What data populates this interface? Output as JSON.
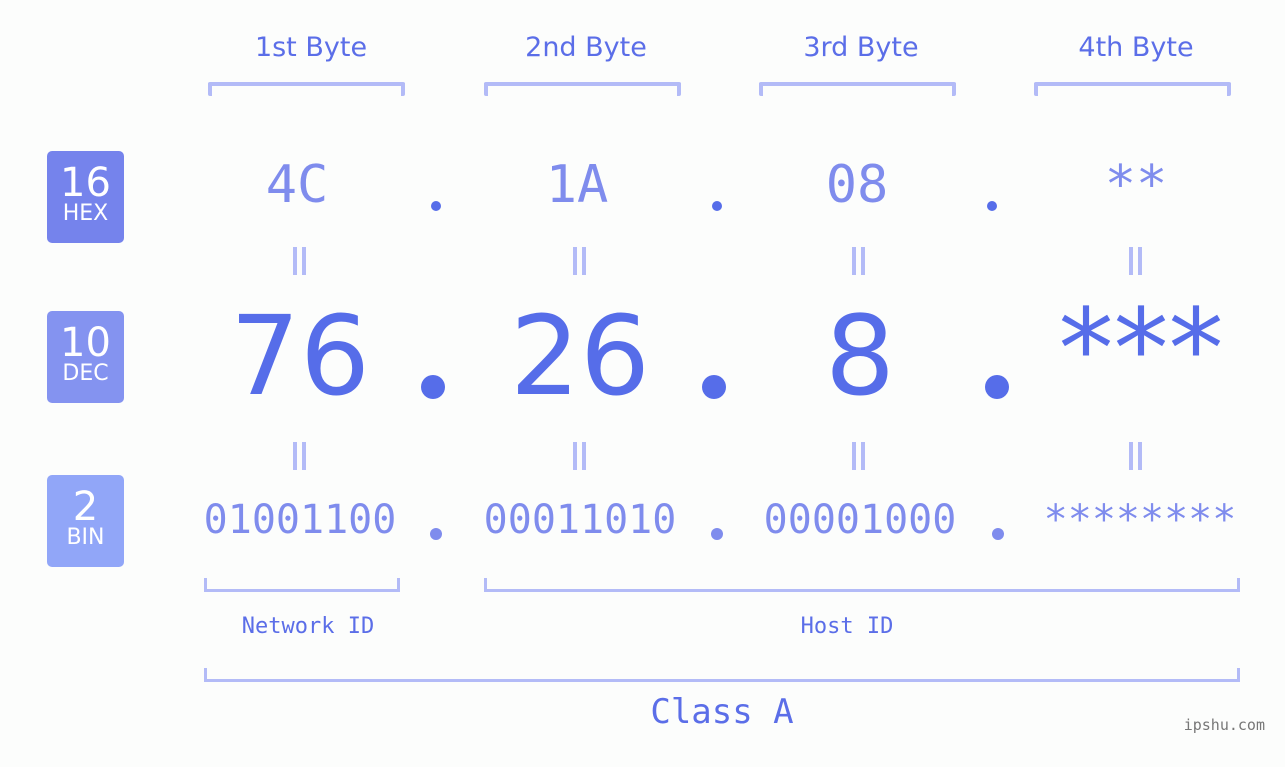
{
  "bytes": [
    {
      "label": "1st Byte",
      "hex": "4C",
      "dec": "76",
      "bin": "01001100"
    },
    {
      "label": "2nd Byte",
      "hex": "1A",
      "dec": "26",
      "bin": "00011010"
    },
    {
      "label": "3rd Byte",
      "hex": "08",
      "dec": "8",
      "bin": "00001000"
    },
    {
      "label": "4th Byte",
      "hex": "**",
      "dec": "***",
      "bin": "********"
    }
  ],
  "badges": {
    "hex": {
      "num": "16",
      "label": "HEX",
      "color": "#7583ec"
    },
    "dec": {
      "num": "10",
      "label": "DEC",
      "color": "#8493f0"
    },
    "bin": {
      "num": "2",
      "label": "BIN",
      "color": "#91a6f8"
    }
  },
  "labels": {
    "network_id": "Network ID",
    "host_id": "Host ID",
    "ip_class": "Class A"
  },
  "colors": {
    "accent": "#566de9",
    "light": "#7f8ced",
    "bracket": "#b3bbf7"
  },
  "watermark": "ipshu.com"
}
